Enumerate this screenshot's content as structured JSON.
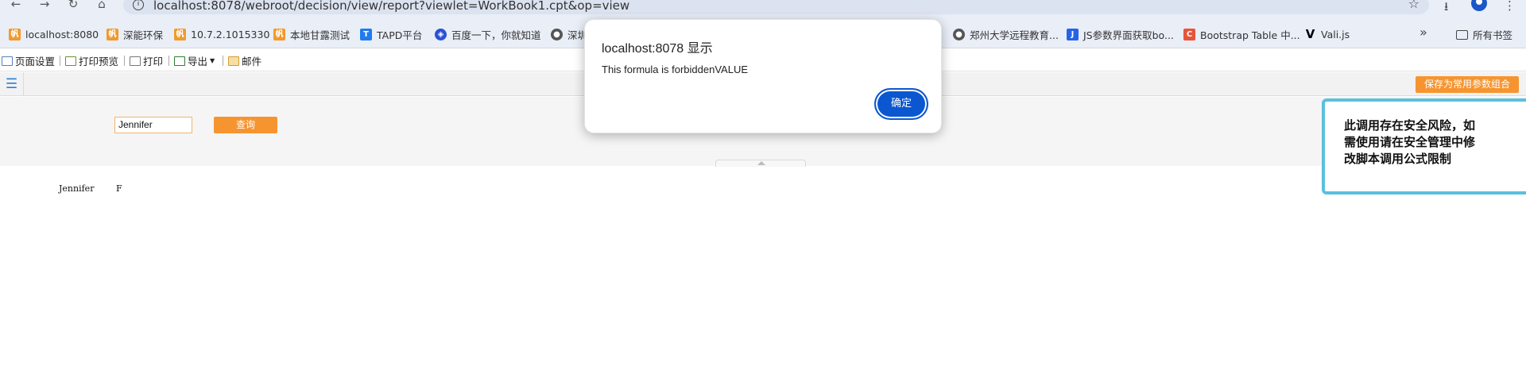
{
  "browser": {
    "url": "localhost:8078/webroot/decision/view/report?viewlet=WorkBook1.cpt&op=view"
  },
  "bookmarks": {
    "items": [
      {
        "label": "localhost:8080",
        "icon": "finereport-icon"
      },
      {
        "label": "深能环保",
        "icon": "finereport-icon"
      },
      {
        "label": "10.7.2.1015330",
        "icon": "finereport-icon"
      },
      {
        "label": "本地甘露测试",
        "icon": "finereport-icon"
      },
      {
        "label": "TAPD平台",
        "icon": "tapd-icon"
      },
      {
        "label": "百度一下，你就知道",
        "icon": "baidu-icon"
      },
      {
        "label": "深圳",
        "icon": "globe-icon"
      },
      {
        "label": "郑州大学远程教育...",
        "icon": "globe-icon"
      },
      {
        "label": "JS参数界面获取bo...",
        "icon": "js-icon"
      },
      {
        "label": "Bootstrap Table 中...",
        "icon": "bootstrap-icon"
      },
      {
        "label": "Vali.js",
        "icon": "vali-icon"
      }
    ],
    "all_bookmarks": "所有书签"
  },
  "toolbar": {
    "page_setup": "页面设置",
    "print_preview": "打印预览",
    "print": "打印",
    "export": "导出",
    "mail": "邮件"
  },
  "params": {
    "save_combo": "保存为常用参数组合",
    "name_value": "Jennifer",
    "query": "查询"
  },
  "report": {
    "cell_name": "Jennifer",
    "cell_gender": "F"
  },
  "dialog": {
    "title": "localhost:8078 显示",
    "message": "This formula is forbiddenVALUE",
    "ok": "确定"
  },
  "warning": {
    "text": "此调用存在安全风险，如需使用请在安全管理中修改脚本调用公式限制"
  },
  "colors": {
    "accent_orange": "#f69530",
    "dialog_button": "#0b57d0",
    "warning_border": "#5bc0de"
  }
}
